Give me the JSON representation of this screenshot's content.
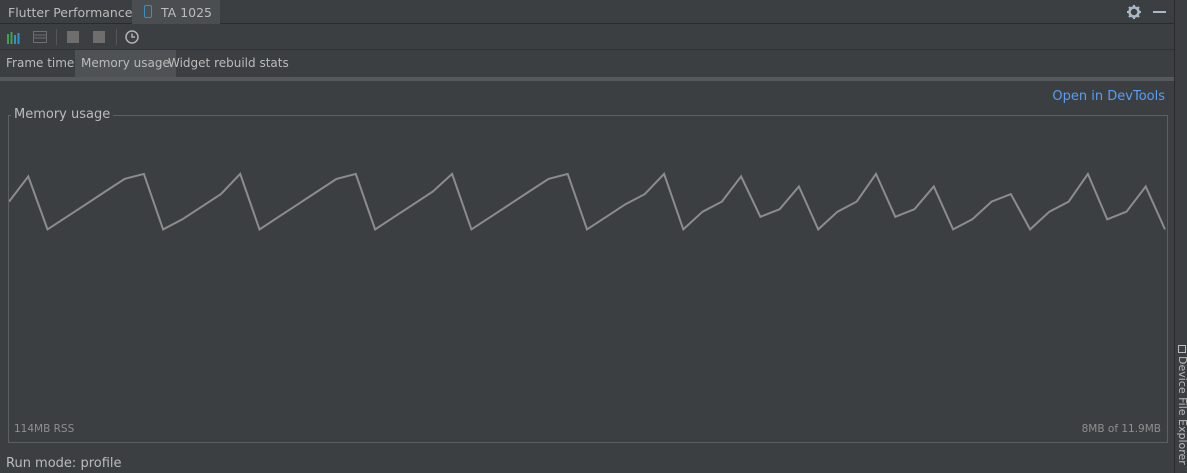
{
  "window": {
    "title": "Flutter Performance",
    "device_tab": "TA 1025"
  },
  "toolbar": {
    "icons": [
      "performance-overlay-icon",
      "debug-paint-icon",
      "stop-icon",
      "stop-icon",
      "clock-icon"
    ]
  },
  "tabs": [
    {
      "label": "Frame times",
      "active": false
    },
    {
      "label": "Memory usage",
      "active": true
    },
    {
      "label": "Widget rebuild stats",
      "active": false
    }
  ],
  "devtools_link": "Open in DevTools",
  "memory_panel": {
    "title": "Memory usage",
    "rss": "114MB RSS",
    "heap": "8MB of 11.9MB"
  },
  "status": "Run mode: profile",
  "side_panel": "Device File Explorer",
  "colors": {
    "background": "#3c3f41",
    "link": "#589df6",
    "chart_line": "#8c8c8c",
    "device_icon": "#3592c4"
  },
  "chart_data": {
    "type": "line",
    "title": "Memory usage",
    "series": [
      {
        "values": [
          8.9,
          9.9,
          7.8,
          8.3,
          8.8,
          9.3,
          9.8,
          10.0,
          7.8,
          8.2,
          8.7,
          9.2,
          10.0,
          7.8,
          8.3,
          8.8,
          9.3,
          9.8,
          10.0,
          7.8,
          8.3,
          8.8,
          9.3,
          10.0,
          7.8,
          8.3,
          8.8,
          9.3,
          9.8,
          10.0,
          7.8,
          8.3,
          8.8,
          9.2,
          10.0,
          7.8,
          8.5,
          8.9,
          9.9,
          8.3,
          8.6,
          9.5,
          7.8,
          8.5,
          8.9,
          10.0,
          8.3,
          8.6,
          9.5,
          7.8,
          8.2,
          8.9,
          9.2,
          7.8,
          8.5,
          8.9,
          10.0,
          8.2,
          8.5,
          9.5,
          7.8
        ]
      }
    ]
  }
}
